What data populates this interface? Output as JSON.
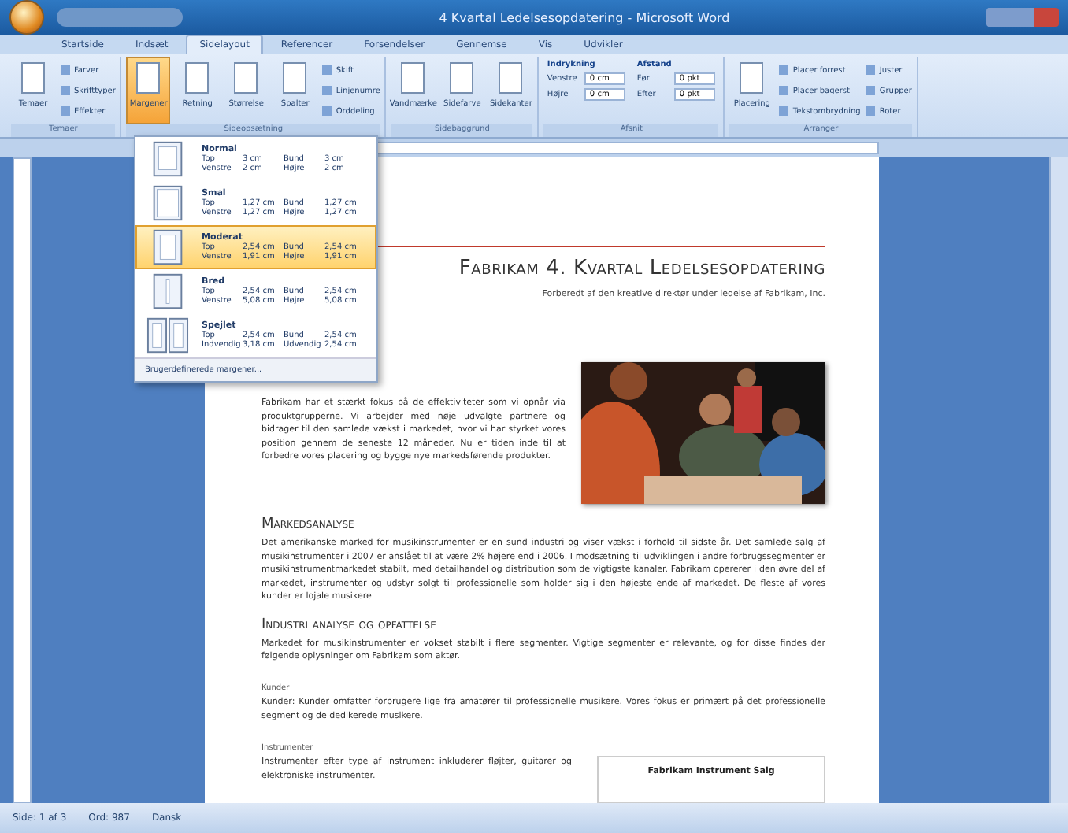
{
  "window": {
    "title": "4 Kvartal Ledelsesopdatering - Microsoft Word"
  },
  "tabs": [
    {
      "label": "Startside",
      "selected": false
    },
    {
      "label": "Indsæt",
      "selected": false
    },
    {
      "label": "Sidelayout",
      "selected": true
    },
    {
      "label": "Referencer",
      "selected": false
    },
    {
      "label": "Forsendelser",
      "selected": false
    },
    {
      "label": "Gennemse",
      "selected": false
    },
    {
      "label": "Vis",
      "selected": false
    },
    {
      "label": "Udvikler",
      "selected": false
    }
  ],
  "ribbon": {
    "groups": [
      {
        "label": "Temaer",
        "items": [
          {
            "kind": "large",
            "label": "Temaer",
            "selected": false
          },
          {
            "kind": "stack",
            "labels": [
              "Farver",
              "Skrifttyper",
              "Effekter"
            ]
          }
        ]
      },
      {
        "label": "Sideopsætning",
        "items": [
          {
            "kind": "large",
            "label": "Margener",
            "selected": true
          },
          {
            "kind": "large",
            "label": "Retning",
            "selected": false
          },
          {
            "kind": "large",
            "label": "Størrelse",
            "selected": false
          },
          {
            "kind": "large",
            "label": "Spalter",
            "selected": false
          },
          {
            "kind": "stack",
            "labels": [
              "Skift",
              "Linjenumre",
              "Orddeling"
            ]
          }
        ]
      },
      {
        "label": "Sidebaggrund",
        "items": [
          {
            "kind": "large",
            "label": "Vandmærke",
            "selected": false
          },
          {
            "kind": "large",
            "label": "Sidefarve",
            "selected": false
          },
          {
            "kind": "large",
            "label": "Sidekanter",
            "selected": false
          }
        ]
      },
      {
        "label": "Afsnit",
        "items": [
          {
            "kind": "fields",
            "title": "Indrykning",
            "rows": [
              {
                "label": "Venstre",
                "value": "0 cm"
              },
              {
                "label": "Højre",
                "value": "0 cm"
              }
            ]
          },
          {
            "kind": "fields",
            "title": "Afstand",
            "rows": [
              {
                "label": "Før",
                "value": "0 pkt"
              },
              {
                "label": "Efter",
                "value": "0 pkt"
              }
            ]
          }
        ]
      },
      {
        "label": "Arranger",
        "items": [
          {
            "kind": "large",
            "label": "Placering",
            "selected": false
          },
          {
            "kind": "stack",
            "labels": [
              "Placer forrest",
              "Placer bagerst",
              "Tekstombrydning"
            ]
          },
          {
            "kind": "stack",
            "labels": [
              "Juster",
              "Grupper",
              "Roter"
            ]
          }
        ]
      }
    ]
  },
  "margins_menu": {
    "items": [
      {
        "name": "Normal",
        "kind": "normal",
        "selected": false,
        "rows": [
          [
            "Top",
            "3 cm",
            "Bund",
            "3 cm"
          ],
          [
            "Venstre",
            "2 cm",
            "Højre",
            "2 cm"
          ]
        ]
      },
      {
        "name": "Smal",
        "kind": "narrow",
        "selected": false,
        "rows": [
          [
            "Top",
            "1,27 cm",
            "Bund",
            "1,27 cm"
          ],
          [
            "Venstre",
            "1,27 cm",
            "Højre",
            "1,27 cm"
          ]
        ]
      },
      {
        "name": "Moderat",
        "kind": "moderate",
        "selected": true,
        "rows": [
          [
            "Top",
            "2,54 cm",
            "Bund",
            "2,54 cm"
          ],
          [
            "Venstre",
            "1,91 cm",
            "Højre",
            "1,91 cm"
          ]
        ]
      },
      {
        "name": "Bred",
        "kind": "wide",
        "selected": false,
        "rows": [
          [
            "Top",
            "2,54 cm",
            "Bund",
            "2,54 cm"
          ],
          [
            "Venstre",
            "5,08 cm",
            "Højre",
            "5,08 cm"
          ]
        ]
      },
      {
        "name": "Spejlet",
        "kind": "mirrored",
        "selected": false,
        "rows": [
          [
            "Top",
            "2,54 cm",
            "Bund",
            "2,54 cm"
          ],
          [
            "Indvendig",
            "3,18 cm",
            "Udvendig",
            "2,54 cm"
          ]
        ]
      }
    ],
    "footer": "Brugerdefinerede margener..."
  },
  "document": {
    "title": "Fabrikam 4. Kvartal Ledelsesopdatering",
    "subtitle": "Forberedt af den kreative direktør under ledelse af Fabrikam, Inc.",
    "intro": "Fabrikam har et stærkt fokus på de effektiviteter som vi opnår via produktgrupperne. Vi arbejder med nøje udvalgte partnere og bidrager til den samlede vækst i markedet, hvor vi har styrket vores position gennem de seneste 12 måneder. Nu er tiden inde til at forbedre vores placering og bygge nye markedsførende produkter.",
    "sections": [
      {
        "kind": "heading",
        "text": "Markedsanalyse"
      },
      {
        "kind": "body",
        "text": "Det amerikanske marked for musikinstrumenter er en sund industri og viser vækst i forhold til sidste år. Det samlede salg af musikinstrumenter i 2007 er anslået til at være 2% højere end i 2006. I modsætning til udviklingen i andre forbrugssegmenter er musikinstrumentmarkedet stabilt, med detailhandel og distribution som de vigtigste kanaler. Fabrikam opererer i den øvre del af markedet, instrumenter og udstyr solgt til professionelle som holder sig i den højeste ende af markedet. De fleste af vores kunder er lojale musikere."
      },
      {
        "kind": "heading",
        "text": "Industri analyse og opfattelse"
      },
      {
        "kind": "body",
        "text": "Markedet for musikinstrumenter er vokset stabilt i flere segmenter. Vigtige segmenter er relevante, og for disse findes der følgende oplysninger om Fabrikam som aktør."
      },
      {
        "kind": "subheading",
        "text": "Kunder"
      },
      {
        "kind": "body",
        "text": "Kunder: Kunder omfatter forbrugere lige fra amatører til professionelle musikere. Vores fokus er primært på det professionelle segment og de dedikerede musikere."
      },
      {
        "kind": "subheading",
        "text": "Instrumenter"
      }
    ],
    "column_text": "Instrumenter efter type af instrument inkluderer fløjter, guitarer og elektroniske instrumenter.",
    "chart_title": "Fabrikam Instrument Salg"
  },
  "status_bar": {
    "page": "Side: 1 af 3",
    "words": "Ord: 987",
    "language": "Dansk"
  }
}
